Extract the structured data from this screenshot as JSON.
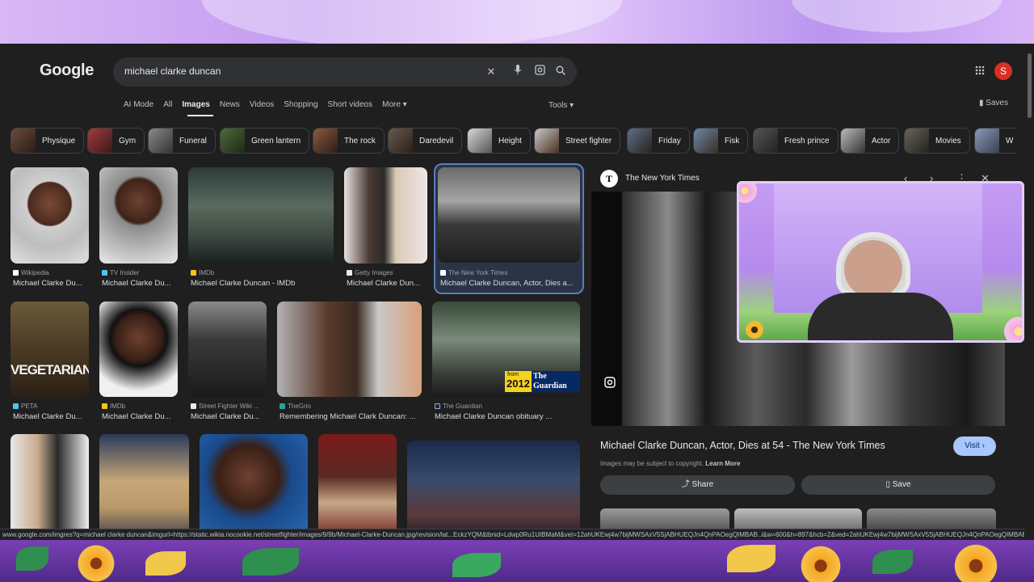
{
  "logo": "Google",
  "search": {
    "query": "michael clarke duncan"
  },
  "account_initial": "S",
  "tabs": [
    "AI Mode",
    "All",
    "Images",
    "News",
    "Videos",
    "Shopping",
    "Short videos",
    "More ▾"
  ],
  "tools_label": "Tools ▾",
  "saves_label": "Saves",
  "chips": [
    "Physique",
    "Gym",
    "Funeral",
    "Green lantern",
    "The rock",
    "Daredevil",
    "Height",
    "Street fighter",
    "Friday",
    "Fisk",
    "Fresh prince",
    "Actor",
    "Movies",
    "W"
  ],
  "results": [
    {
      "source": "Wikipedia",
      "title": "Michael Clarke Du..."
    },
    {
      "source": "TV Insider",
      "title": "Michael Clarke Du..."
    },
    {
      "source": "IMDb",
      "title": "Michael Clarke Duncan - IMDb"
    },
    {
      "source": "Getty Images",
      "title": "Michael Clarke Dun..."
    },
    {
      "source": "The New York Times",
      "title": "Michael Clarke Duncan, Actor, Dies a..."
    },
    {
      "source": "PETA",
      "title": "Michael Clarke Du..."
    },
    {
      "source": "IMDb",
      "title": "Michael Clarke Du..."
    },
    {
      "source": "Street Fighter Wiki ...",
      "title": "Michael Clarke Du..."
    },
    {
      "source": "TheGrio",
      "title": "Remembering Michael Clark Duncan: ..."
    },
    {
      "source": "The Guardian",
      "title": "Michael Clarke Duncan obituary ..."
    }
  ],
  "image_text": {
    "vegetarian": "VEGETARIAN",
    "guardian_from": "from",
    "guardian_year": "2012",
    "guardian_word": "The Guardian"
  },
  "panel": {
    "source": "The New York Times",
    "title": "Michael Clarke Duncan, Actor, Dies at 54 - The New York Times",
    "visit": "Visit ›",
    "copyright": "Images may be subject to copyright.",
    "learn_more": "Learn More",
    "share": "Share",
    "save": "Save"
  },
  "status_url": "www.google.com/imgres?q=michael clarke duncan&imgurl=https://static.wikia.nocookie.net/streetfighter/images/9/9b/Michael-Clarke-Duncan.jpg/revision/lat...EckzYQM&tbnid=Ldwp0Ru1UtBMaM&vet=12ahUKEwj4w7bijMWSAxV5SjABHUEQJn4QnPAOegQIMBAB..i&w=600&h=897&hcb=2&ved=2ahUKEwj4w7bijMWSAxV5SjABHUEQJn4QnPAOegQIMBAB",
  "colors": {
    "background": "#1f1f1f",
    "search_bar": "#303134",
    "visit_button": "#a8c7fa",
    "selected_border": "#5b7fb8",
    "avatar": "#d93025"
  }
}
